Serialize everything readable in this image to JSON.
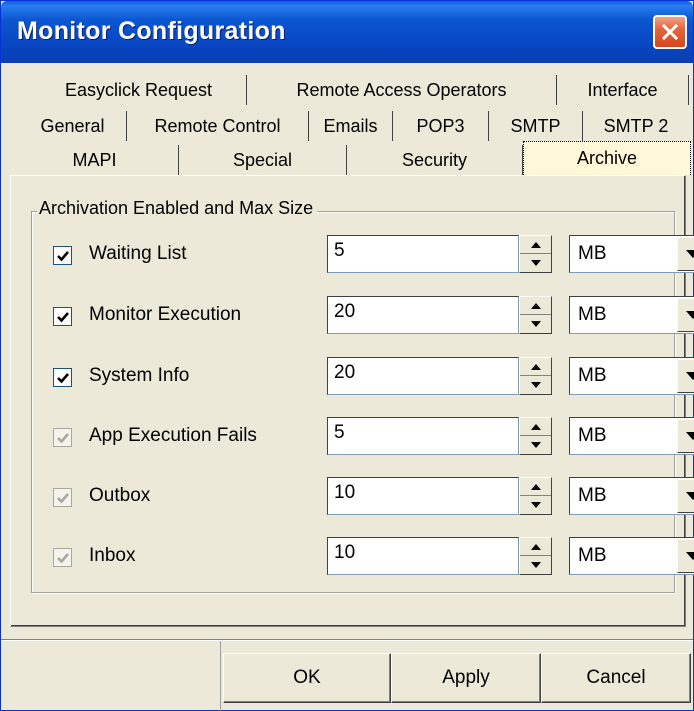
{
  "window": {
    "title": "Monitor Configuration"
  },
  "tabs": {
    "row1": [
      "Easyclick Request",
      "Remote Access Operators",
      "Interface"
    ],
    "row2": [
      "General",
      "Remote Control",
      "Emails",
      "POP3",
      "SMTP",
      "SMTP 2"
    ],
    "row3": [
      "MAPI",
      "Special",
      "Security",
      "Archive"
    ],
    "selected": "Archive"
  },
  "group": {
    "legend": "Archivation Enabled and Max Size"
  },
  "rows": [
    {
      "label": "Waiting List",
      "checked": true,
      "enabled": true,
      "value": "5",
      "unit": "MB"
    },
    {
      "label": "Monitor Execution",
      "checked": true,
      "enabled": true,
      "value": "20",
      "unit": "MB"
    },
    {
      "label": "System Info",
      "checked": true,
      "enabled": true,
      "value": "20",
      "unit": "MB"
    },
    {
      "label": "App Execution Fails",
      "checked": true,
      "enabled": false,
      "value": "5",
      "unit": "MB"
    },
    {
      "label": "Outbox",
      "checked": true,
      "enabled": false,
      "value": "10",
      "unit": "MB"
    },
    {
      "label": "Inbox",
      "checked": true,
      "enabled": false,
      "value": "10",
      "unit": "MB"
    }
  ],
  "buttons": {
    "ok": "OK",
    "apply": "Apply",
    "cancel": "Cancel"
  },
  "colors": {
    "titlebar": "#0a55d0",
    "close": "#e0582f",
    "face": "#ece9d8",
    "selected_tab": "#fff8d8"
  }
}
